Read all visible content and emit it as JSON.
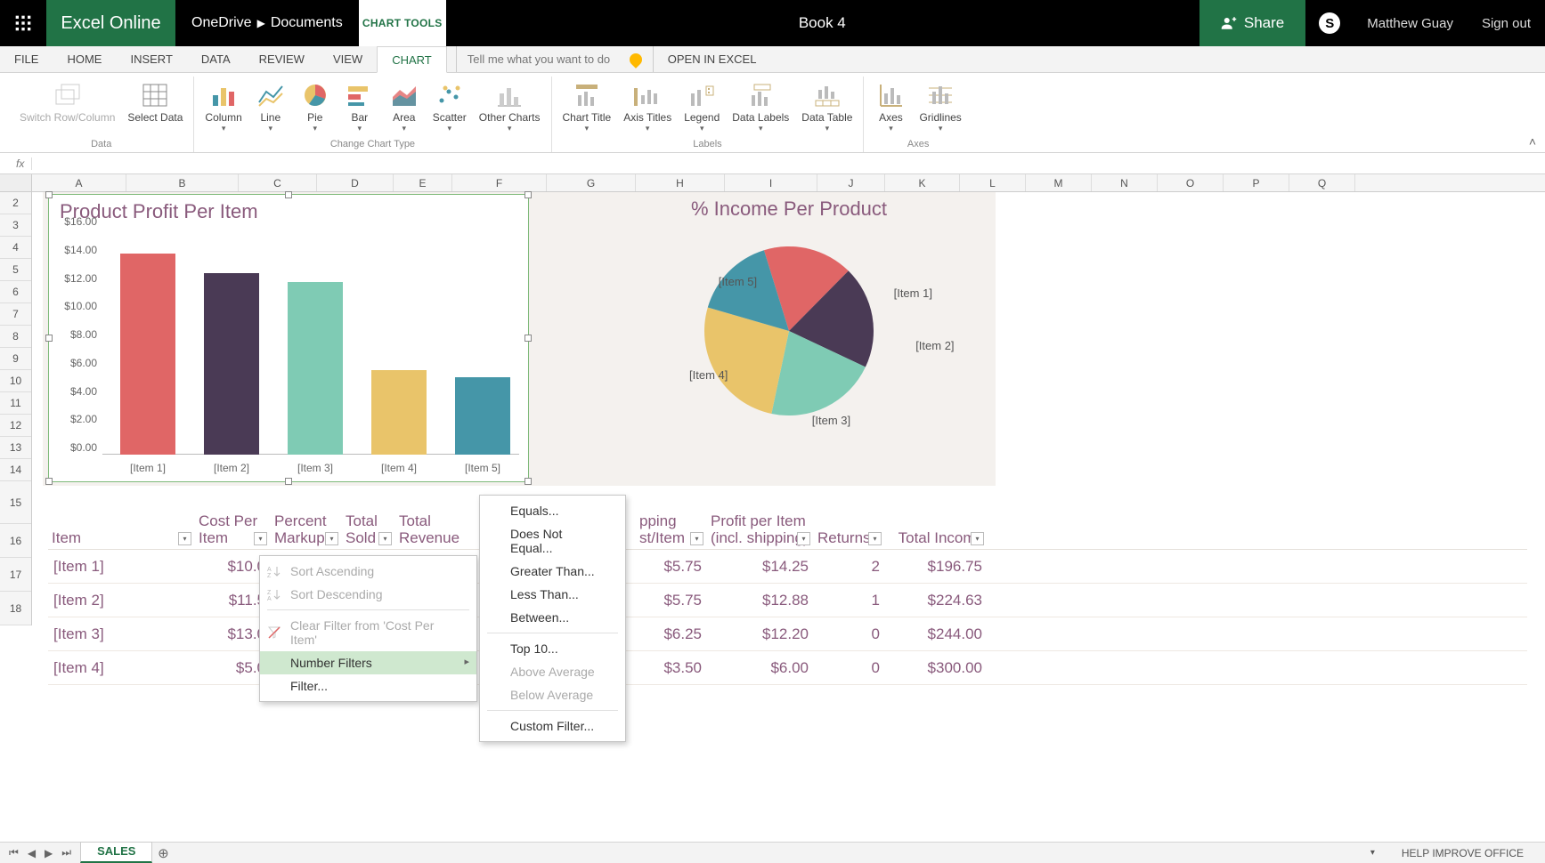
{
  "app": {
    "name": "Excel Online"
  },
  "breadcrumb": {
    "root": "OneDrive",
    "folder": "Documents"
  },
  "context_tab": "CHART TOOLS",
  "document_title": "Book 4",
  "share_label": "Share",
  "user_name": "Matthew Guay",
  "signout_label": "Sign out",
  "tabs": {
    "file": "FILE",
    "home": "HOME",
    "insert": "INSERT",
    "data": "DATA",
    "review": "REVIEW",
    "view": "VIEW",
    "chart": "CHART"
  },
  "tell_me_placeholder": "Tell me what you want to do",
  "open_in_excel": "OPEN IN EXCEL",
  "ribbon": {
    "groups": {
      "data": "Data",
      "change_type": "Change Chart Type",
      "labels": "Labels",
      "axes": "Axes"
    },
    "btns": {
      "switch": "Switch Row/Column",
      "select_data": "Select Data",
      "column": "Column",
      "line": "Line",
      "pie": "Pie",
      "bar": "Bar",
      "area": "Area",
      "scatter": "Scatter",
      "other": "Other Charts",
      "chart_title": "Chart Title",
      "axis_titles": "Axis Titles",
      "legend": "Legend",
      "data_labels": "Data Labels",
      "data_table": "Data Table",
      "axes_btn": "Axes",
      "gridlines": "Gridlines"
    }
  },
  "columns": [
    "A",
    "B",
    "C",
    "D",
    "E",
    "F",
    "G",
    "H",
    "I",
    "J",
    "K",
    "L",
    "M",
    "N",
    "O",
    "P",
    "Q"
  ],
  "rows": [
    2,
    3,
    4,
    5,
    6,
    7,
    8,
    9,
    10,
    11,
    12,
    13,
    14,
    15,
    16,
    17,
    18
  ],
  "chart_data": [
    {
      "type": "bar",
      "title": "Product Profit Per Item",
      "categories": [
        "[Item 1]",
        "[Item 2]",
        "[Item 3]",
        "[Item 4]",
        "[Item 5]"
      ],
      "values": [
        14.25,
        12.88,
        12.2,
        6.0,
        5.5
      ],
      "colors": [
        "#e06666",
        "#4a3a55",
        "#7fcbb4",
        "#e9c46a",
        "#4596a8"
      ],
      "ylim": [
        0,
        16
      ],
      "yticks": [
        "$0.00",
        "$2.00",
        "$4.00",
        "$6.00",
        "$8.00",
        "$10.00",
        "$12.00",
        "$14.00",
        "$16.00"
      ],
      "xlabel": "",
      "ylabel": ""
    },
    {
      "type": "pie",
      "title": "% Income Per Product",
      "categories": [
        "[Item 1]",
        "[Item 2]",
        "[Item 3]",
        "[Item 4]",
        "[Item 5]"
      ],
      "values": [
        196.75,
        224.63,
        244.0,
        300.0,
        180.0
      ],
      "colors": [
        "#e06666",
        "#4a3a55",
        "#7fcbb4",
        "#e9c46a",
        "#4596a8"
      ]
    }
  ],
  "table": {
    "headers": {
      "item": "Item",
      "cost": "Cost Per Item",
      "markup": "Percent Markup",
      "sold": "Total Sold",
      "revenue": "Total Revenue",
      "ship": "pping st/Item",
      "profit": "Profit per Item (incl. shipping)",
      "returns": "Returns",
      "income": "Total Income"
    },
    "rows": [
      {
        "item": "[Item 1]",
        "cost": "$10.0",
        "ship": "$5.75",
        "profit": "$14.25",
        "returns": "2",
        "income": "$196.75"
      },
      {
        "item": "[Item 2]",
        "cost": "$11.5",
        "ship": "$5.75",
        "profit": "$12.88",
        "returns": "1",
        "income": "$224.63"
      },
      {
        "item": "[Item 3]",
        "cost": "$13.0",
        "ship": "$6.25",
        "profit": "$12.20",
        "returns": "0",
        "income": "$244.00"
      },
      {
        "item": "[Item 4]",
        "cost": "$5.0",
        "ship": "$3.50",
        "profit": "$6.00",
        "returns": "0",
        "income": "$300.00"
      }
    ]
  },
  "sort_menu": {
    "asc": "Sort Ascending",
    "desc": "Sort Descending",
    "clear": "Clear Filter from 'Cost Per Item'",
    "numfilt": "Number Filters",
    "filter": "Filter..."
  },
  "filter_menu": {
    "equals": "Equals...",
    "neq": "Does Not Equal...",
    "gt": "Greater Than...",
    "lt": "Less Than...",
    "between": "Between...",
    "top10": "Top 10...",
    "above": "Above Average",
    "below": "Below Average",
    "custom": "Custom Filter..."
  },
  "sheet": {
    "active": "SALES"
  },
  "footer": {
    "improve": "HELP IMPROVE OFFICE"
  }
}
